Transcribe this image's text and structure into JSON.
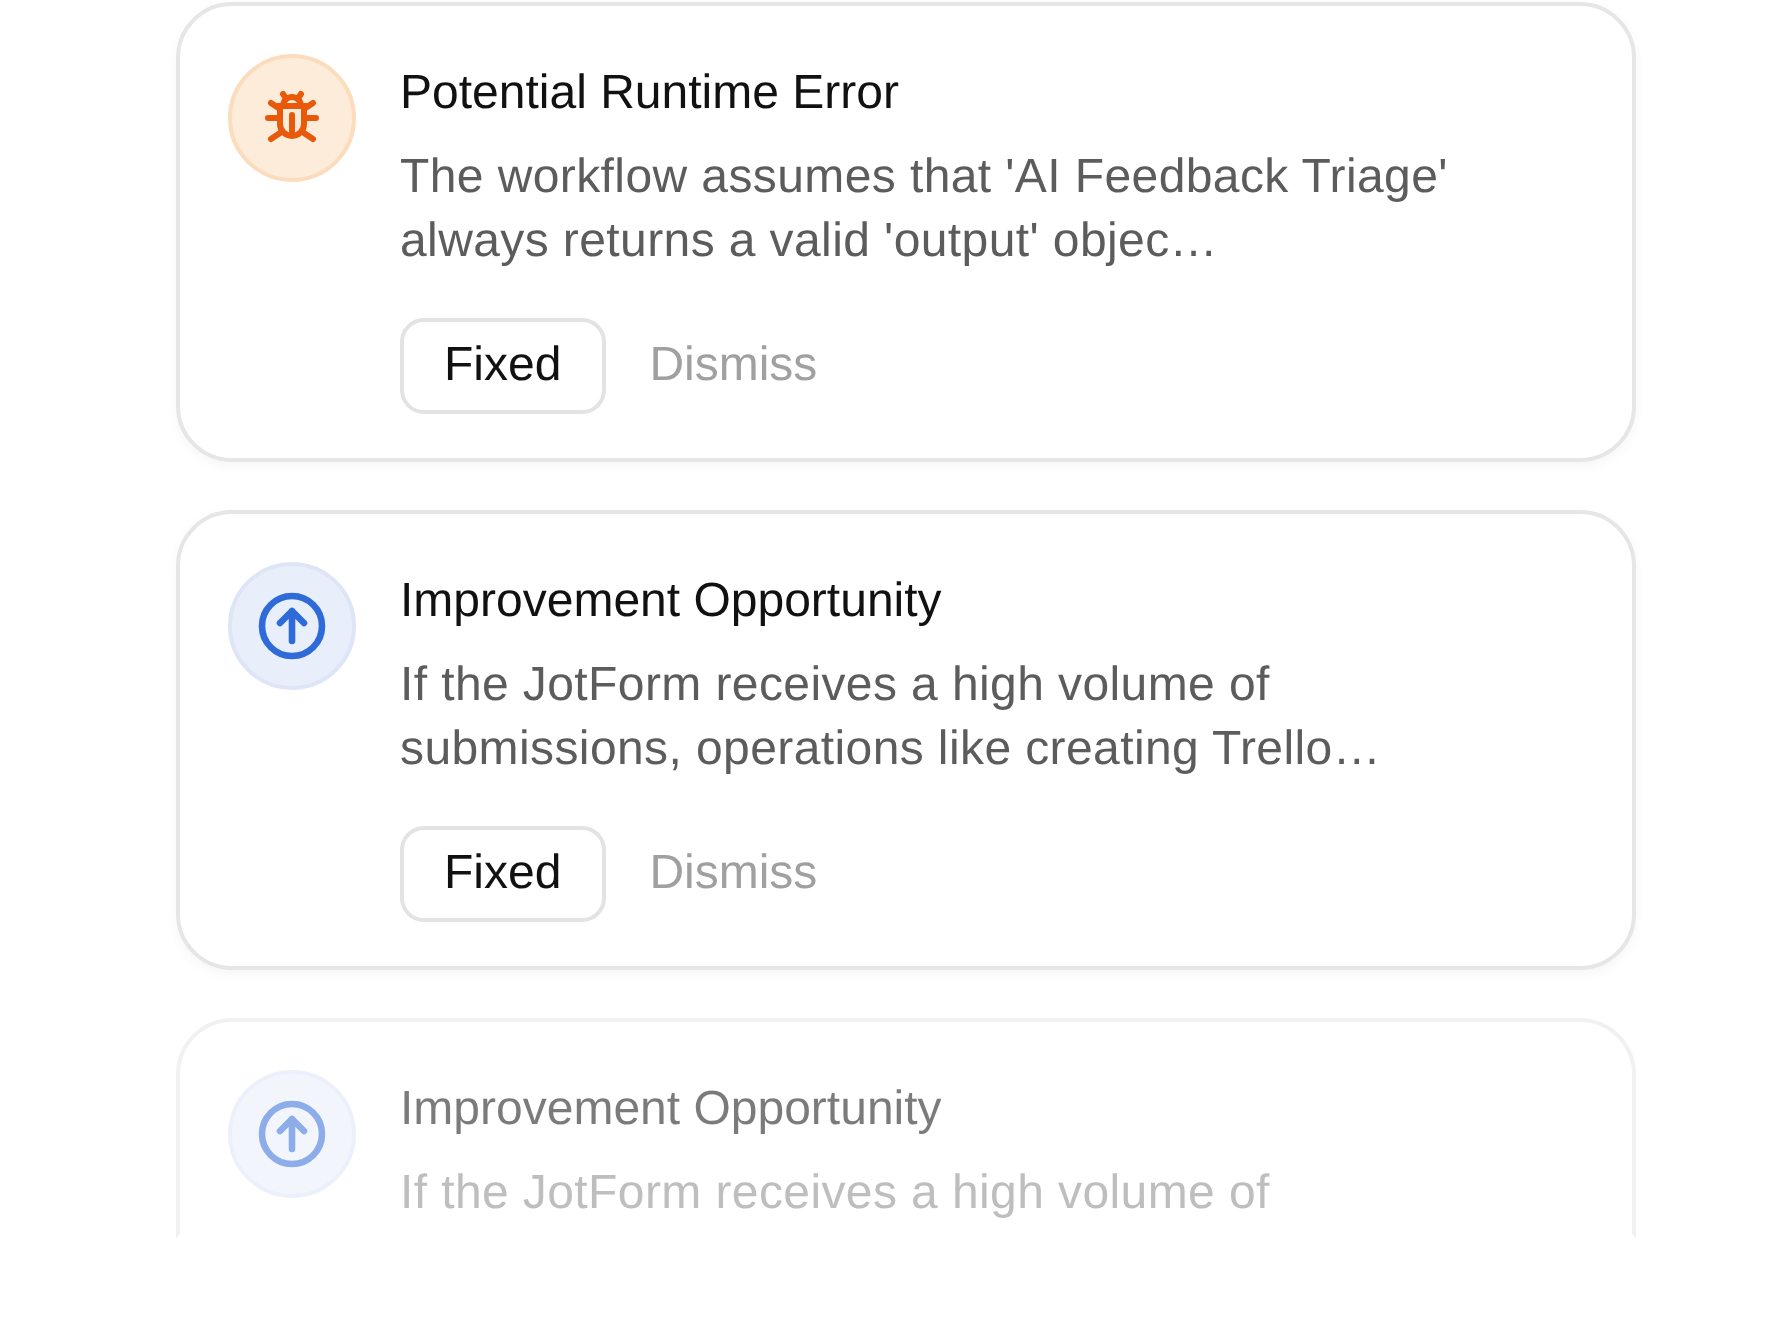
{
  "cards": [
    {
      "kind": "bug",
      "faded": false,
      "title": "Potential Runtime Error",
      "description": "The workflow assumes that 'AI Feedback Triage' always returns a valid 'output' objec…",
      "buttons": [
        "Fixed",
        "Dismiss"
      ]
    },
    {
      "kind": "improvement",
      "faded": false,
      "title": "Improvement Opportunity",
      "description": "If the JotForm receives a high volume of submissions, operations like creating Trello…",
      "buttons": [
        "Fixed",
        "Dismiss"
      ]
    },
    {
      "kind": "improvement",
      "faded": true,
      "title": "Improvement Opportunity",
      "description": "If the JotForm receives a high volume of"
    }
  ]
}
